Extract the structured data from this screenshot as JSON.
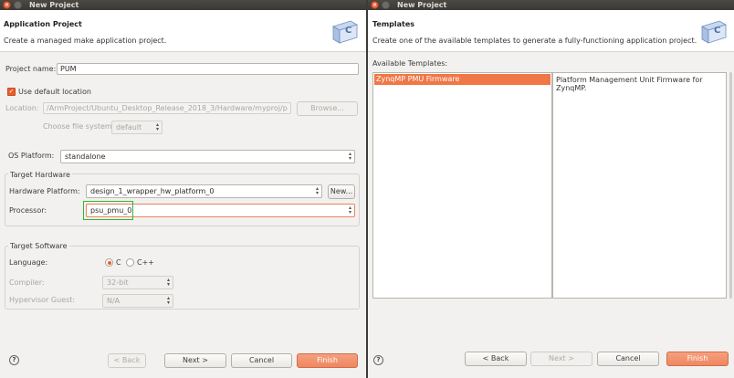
{
  "left": {
    "window_title": "New Project",
    "header_title": "Application Project",
    "header_desc": "Create a managed make application project.",
    "project_name_label": "Project name:",
    "project_name_value": "PUM",
    "use_default_location_label": "Use default location",
    "location_label": "Location:",
    "location_value": "/ArmProject/Ubuntu_Desktop_Release_2018_3/Hardware/myproj/p",
    "browse_label": "Browse...",
    "choose_fs_label": "Choose file system:",
    "choose_fs_value": "default",
    "os_platform_label": "OS Platform:",
    "os_platform_value": "standalone",
    "target_hardware_label": "Target Hardware",
    "hw_platform_label": "Hardware Platform:",
    "hw_platform_value": "design_1_wrapper_hw_platform_0",
    "new_label": "New...",
    "processor_label": "Processor:",
    "processor_value": "psu_pmu_0",
    "target_software_label": "Target Software",
    "language_label": "Language:",
    "lang_c": "C",
    "lang_cpp": "C++",
    "compiler_label": "Compiler:",
    "compiler_value": "32-bit",
    "hypervisor_label": "Hypervisor Guest:",
    "hypervisor_value": "N/A",
    "back_label": "< Back",
    "next_label": "Next >",
    "cancel_label": "Cancel",
    "finish_label": "Finish"
  },
  "right": {
    "window_title": "New Project",
    "header_title": "Templates",
    "header_desc": "Create one of the available templates to generate a fully-functioning application project.",
    "available_label": "Available Templates:",
    "templates": [
      "ZynqMP PMU Firmware"
    ],
    "template_description": "Platform Management Unit Firmware for ZynqMP.",
    "back_label": "< Back",
    "next_label": "Next >",
    "cancel_label": "Cancel",
    "finish_label": "Finish"
  },
  "colors": {
    "accent": "#f07746",
    "highlight_box": "#2db82d",
    "titlebar": "#3c3b37"
  },
  "icons": [
    "close-icon",
    "minimize-icon",
    "wizard-banner-icon",
    "checkbox-checked-icon",
    "help-icon",
    "combo-arrows-icon"
  ]
}
